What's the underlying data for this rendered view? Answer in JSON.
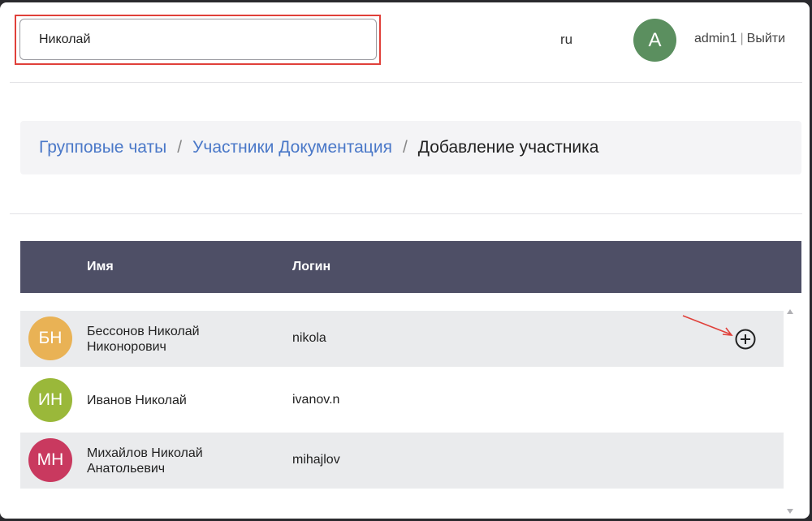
{
  "header": {
    "search_value": "Николай",
    "language": "ru",
    "avatar_letter": "A",
    "username": "admin1",
    "separator": "|",
    "logout": "Выйти"
  },
  "breadcrumb": {
    "items": [
      "Групповые чаты",
      "Участники Документация"
    ],
    "separator": "/",
    "current": "Добавление участника"
  },
  "table": {
    "columns": {
      "name": "Имя",
      "login": "Логин"
    },
    "rows": [
      {
        "initials": "БН",
        "name_line1": "Бессонов Николай",
        "name_line2": "Никонорович",
        "login": "nikola",
        "avatar_color": "#e9b255"
      },
      {
        "initials": "ИН",
        "name_line1": "Иванов Николай",
        "name_line2": "",
        "login": "ivanov.n",
        "avatar_color": "#9ab83a"
      },
      {
        "initials": "МН",
        "name_line1": "Михайлов Николай",
        "name_line2": "Анатольевич",
        "login": "mihajlov",
        "avatar_color": "#c9395f"
      }
    ]
  },
  "colors": {
    "table_header_bg": "#4e4f66",
    "link": "#4a78c8",
    "highlight": "#e0403a",
    "avatar_main": "#5b8f5f"
  },
  "icons": {
    "add": "plus-circle-icon",
    "annotation": "red-arrow-icon"
  }
}
